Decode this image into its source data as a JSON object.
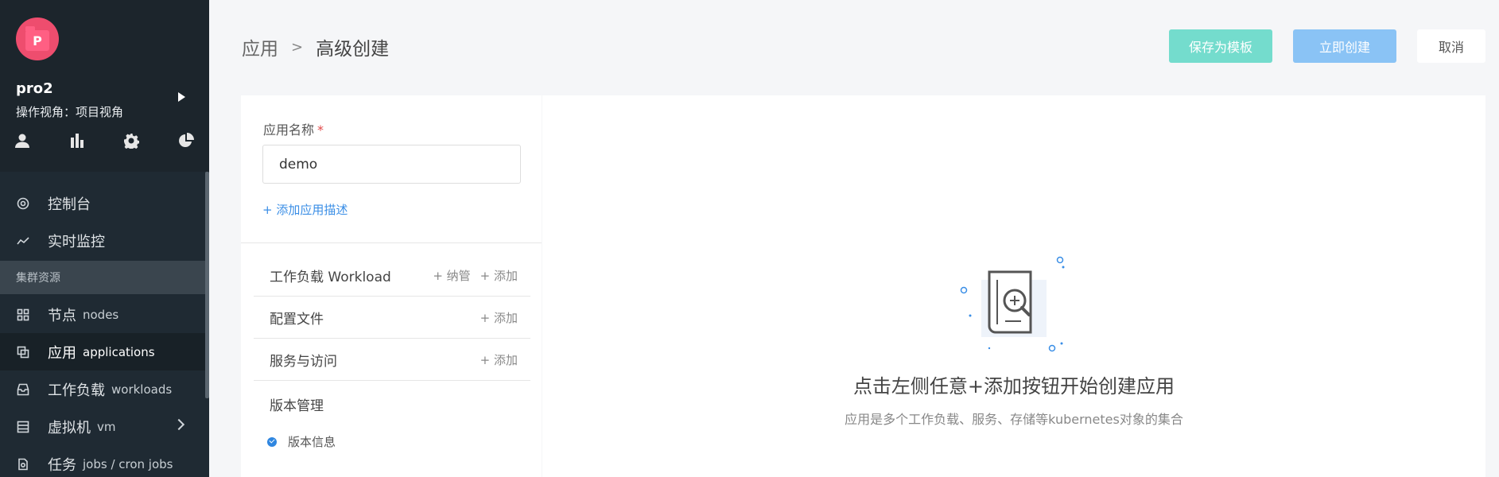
{
  "sidebar": {
    "avatar_letter": "P",
    "project_name": "pro2",
    "view_label": "操作视角：项目视角",
    "top_icons": [
      "user-icon",
      "bar-chart-icon",
      "gear-icon",
      "pie-chart-icon"
    ],
    "items": [
      {
        "label": "控制台",
        "en": "",
        "icon": "dashboard-icon"
      },
      {
        "label": "实时监控",
        "en": "",
        "icon": "trend-icon"
      }
    ],
    "group_label": "集群资源",
    "group_items": [
      {
        "label": "节点",
        "en": "nodes",
        "icon": "grid-icon"
      },
      {
        "label": "应用",
        "en": "applications",
        "icon": "copy-icon",
        "active": true
      },
      {
        "label": "工作负载",
        "en": "workloads",
        "icon": "inbox-icon"
      },
      {
        "label": "虚拟机",
        "en": "vm",
        "icon": "server-icon"
      },
      {
        "label": "任务",
        "en": "jobs / cron jobs",
        "icon": "file-icon"
      }
    ]
  },
  "header": {
    "breadcrumb_parent": "应用",
    "breadcrumb_sep": ">",
    "breadcrumb_current": "高级创建",
    "save_template_label": "保存为模板",
    "create_label": "立即创建",
    "cancel_label": "取消"
  },
  "form": {
    "app_name_label": "应用名称",
    "required_mark": "*",
    "app_name_value": "demo",
    "add_desc_label": "+ 添加应用描述",
    "sections": [
      {
        "title": "工作负载 Workload",
        "actions": [
          "+ 纳管",
          "+ 添加"
        ]
      },
      {
        "title": "配置文件",
        "actions": [
          "+ 添加"
        ]
      },
      {
        "title": "服务与访问",
        "actions": [
          "+ 添加"
        ]
      }
    ],
    "version_title": "版本管理",
    "version_info": "版本信息"
  },
  "empty_state": {
    "title": "点击左侧任意+添加按钮开始创建应用",
    "subtitle": "应用是多个工作负载、服务、存储等kubernetes对象的集合"
  },
  "colors": {
    "sidebar_bg": "#1f2a33",
    "avatar": "#ee4d6e",
    "primary": "#3a8ee6",
    "teal_button": "#74dccd",
    "blue_button": "#8ac3f5"
  }
}
